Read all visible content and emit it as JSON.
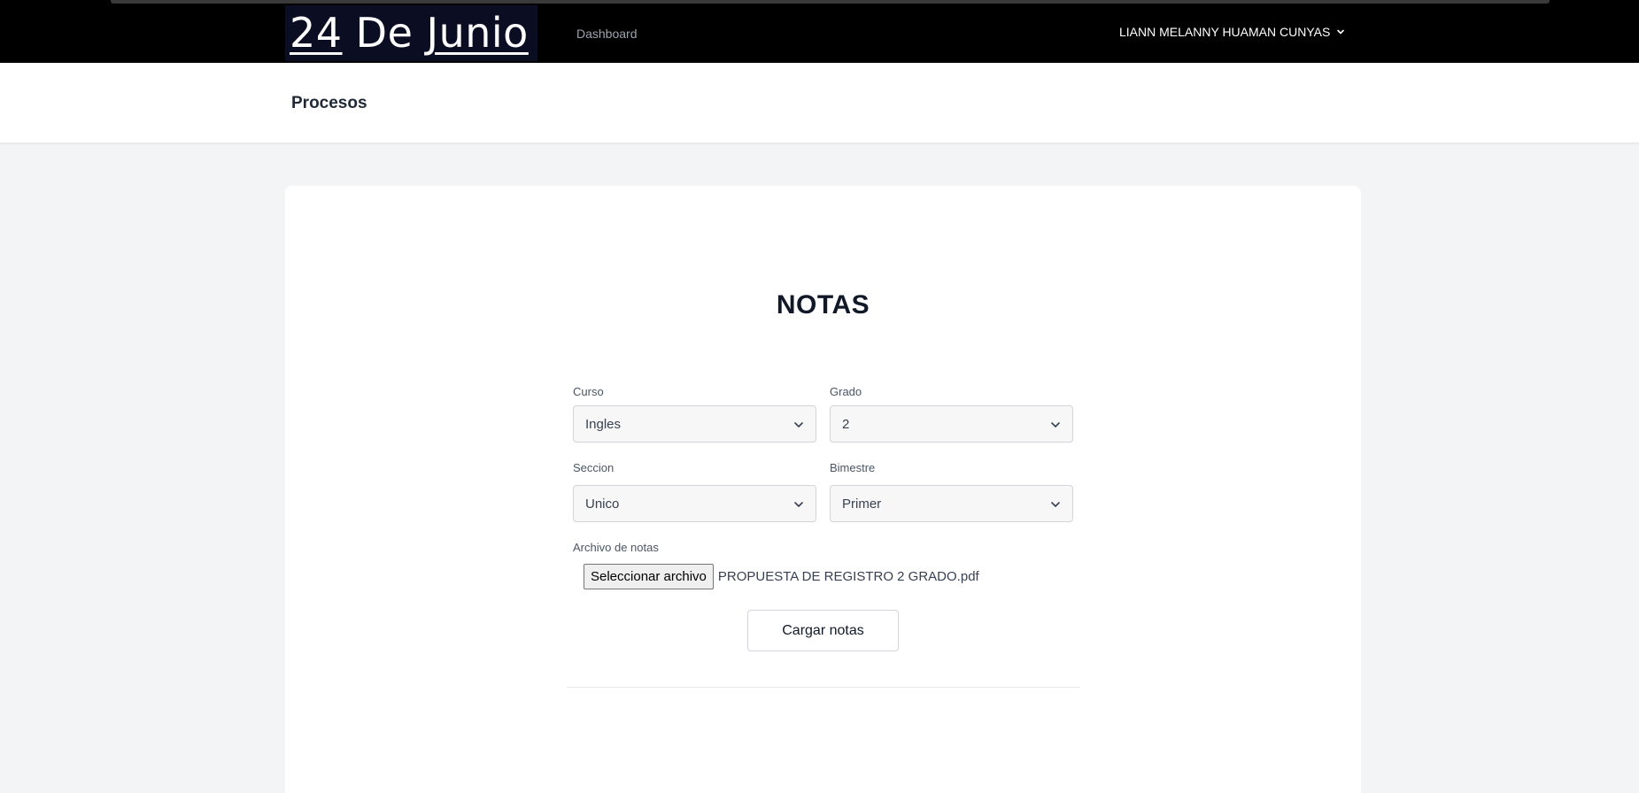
{
  "topbar": {
    "logo": {
      "part1": "24",
      "part2": " De ",
      "part3": "Junio"
    },
    "nav_dashboard": "Dashboard",
    "user_name": "LIANN MELANNY HUAMAN CUNYAS",
    "user_menu_icon": "chevron-down-icon"
  },
  "header": {
    "title": "Procesos"
  },
  "form": {
    "title": "NOTAS",
    "curso": {
      "label": "Curso",
      "value": "Ingles"
    },
    "grado": {
      "label": "Grado",
      "value": "2"
    },
    "seccion": {
      "label": "Seccion",
      "value": "Unico"
    },
    "bimestre": {
      "label": "Bimestre",
      "value": "Primer"
    },
    "archivo": {
      "label": "Archivo de notas",
      "button_label": "Seleccionar archivo",
      "file_name": "PROPUESTA DE REGISTRO 2 GRADO.pdf"
    },
    "submit_label": "Cargar notas",
    "select_icon": "chevron-down-icon"
  },
  "colors": {
    "topbar_bg": "#000000",
    "logo_bg": "#0b0e22",
    "page_bg": "#f3f4f6",
    "card_bg": "#ffffff"
  }
}
